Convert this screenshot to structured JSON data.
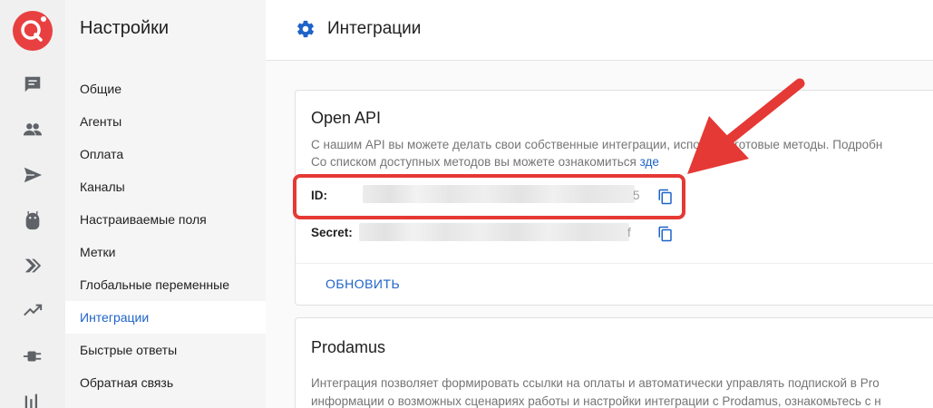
{
  "rail": {
    "icons": [
      "app-logo",
      "chat-icon",
      "people-icon",
      "send-icon",
      "bot-icon",
      "double-chevron-icon",
      "trend-icon",
      "plug-icon",
      "bar-chart-icon"
    ]
  },
  "menu": {
    "title": "Настройки",
    "items": [
      {
        "label": "Общие"
      },
      {
        "label": "Агенты"
      },
      {
        "label": "Оплата"
      },
      {
        "label": "Каналы"
      },
      {
        "label": "Настраиваемые поля"
      },
      {
        "label": "Метки"
      },
      {
        "label": "Глобальные переменные"
      },
      {
        "label": "Интеграции"
      },
      {
        "label": "Быстрые ответы"
      },
      {
        "label": "Обратная связь"
      }
    ],
    "active_index": 7
  },
  "header": {
    "title": "Интеграции"
  },
  "open_api": {
    "title": "Open API",
    "desc_line1": "С нашим API вы можете делать свои собственные интеграции, используя готовые методы. Подробн",
    "desc_line2_prefix": "Со списком доступных методов вы можете ознакомиться ",
    "desc_line2_link": "зде",
    "id_label": "ID:",
    "id_tail": "5",
    "secret_label": "Secret:",
    "secret_tail": "f",
    "refresh_label": "ОБНОВИТЬ"
  },
  "prodamus": {
    "title": "Prodamus",
    "desc_line1": "Интеграция позволяет формировать ссылки на оплаты и автоматически управлять подпиской в Pro",
    "desc_line2": "информации о возможных сценариях работы и настройки интеграции с Prodamus, ознакомьтесь с н"
  },
  "colors": {
    "accent": "#1e63c8",
    "logo": "#e84040",
    "annotation": "#e53935"
  }
}
